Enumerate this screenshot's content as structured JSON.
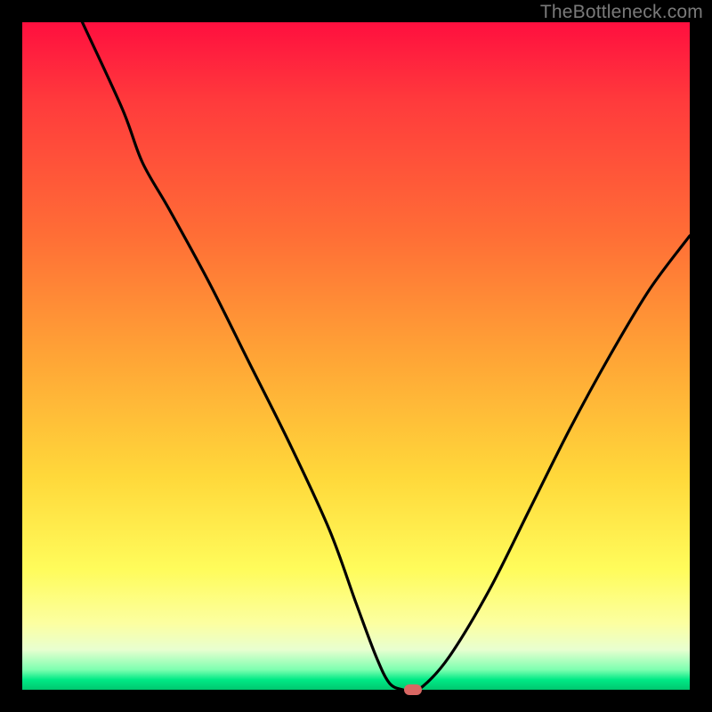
{
  "watermark": "TheBottleneck.com",
  "chart_data": {
    "type": "line",
    "title": "",
    "xlabel": "",
    "ylabel": "",
    "xlim": [
      0,
      100
    ],
    "ylim": [
      0,
      100
    ],
    "series": [
      {
        "name": "bottleneck-curve",
        "x": [
          9,
          15,
          18,
          22,
          28,
          34,
          40,
          46,
          50,
          53,
          55,
          57,
          58,
          60,
          64,
          70,
          76,
          82,
          88,
          94,
          100
        ],
        "y": [
          100,
          87,
          79,
          72,
          61,
          49,
          37,
          24,
          13,
          5,
          1,
          0,
          0,
          0.5,
          5,
          15,
          27,
          39,
          50,
          60,
          68
        ]
      }
    ],
    "marker": {
      "x": 58.5,
      "y": 0
    },
    "gradient_stops": [
      {
        "pos": 0,
        "color": "#ff0f3f"
      },
      {
        "pos": 0.12,
        "color": "#ff3b3c"
      },
      {
        "pos": 0.32,
        "color": "#ff6e36"
      },
      {
        "pos": 0.5,
        "color": "#ffa436"
      },
      {
        "pos": 0.68,
        "color": "#ffd83a"
      },
      {
        "pos": 0.82,
        "color": "#fffc5b"
      },
      {
        "pos": 0.9,
        "color": "#fcffa0"
      },
      {
        "pos": 0.94,
        "color": "#e8ffd0"
      },
      {
        "pos": 0.97,
        "color": "#7dffb0"
      },
      {
        "pos": 0.985,
        "color": "#00e985"
      },
      {
        "pos": 1.0,
        "color": "#00c76f"
      }
    ]
  }
}
